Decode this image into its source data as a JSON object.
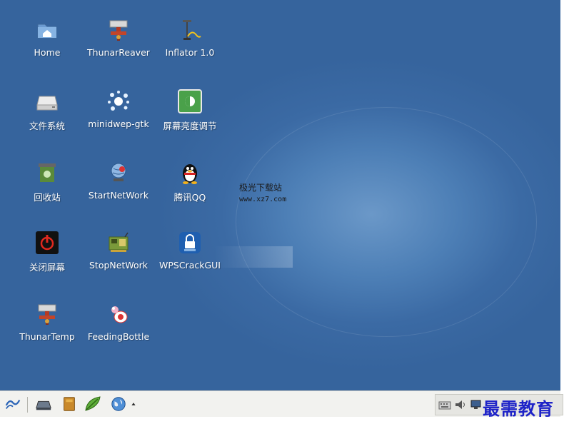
{
  "desktop": {
    "icons": [
      {
        "label": "Home",
        "icon": "home-folder-icon"
      },
      {
        "label": "ThunarReaver",
        "icon": "hydrant-icon"
      },
      {
        "label": "Inflator 1.0",
        "icon": "pump-icon"
      },
      {
        "label": "文件系统",
        "icon": "drive-icon"
      },
      {
        "label": "minidwep-gtk",
        "icon": "splash-icon"
      },
      {
        "label": "屏幕亮度调节",
        "icon": "brightness-icon"
      },
      {
        "label": "回收站",
        "icon": "trash-icon"
      },
      {
        "label": "StartNetWork",
        "icon": "network-globe-icon"
      },
      {
        "label": "腾讯QQ",
        "icon": "penguin-icon"
      },
      {
        "label": "关闭屏幕",
        "icon": "power-icon"
      },
      {
        "label": "StopNetWork",
        "icon": "network-card-icon"
      },
      {
        "label": "WPSCrackGUI",
        "icon": "wps-lock-icon"
      },
      {
        "label": "ThunarTemp",
        "icon": "hydrant-icon"
      },
      {
        "label": "FeedingBottle",
        "icon": "feeding-bottle-icon"
      }
    ],
    "watermark": {
      "line1": "极光下载站",
      "line2": "www.xz7.com"
    }
  },
  "taskbar": {
    "launchers": [
      "app-menu-icon",
      "show-desktop-icon",
      "file-manager-icon",
      "text-editor-icon",
      "web-browser-icon",
      "more-arrow-icon"
    ],
    "tray": [
      "keyboard-icon",
      "volume-icon",
      "network-monitor-icon"
    ]
  },
  "overlay": {
    "logo_text": "最需教育"
  },
  "colors": {
    "desktop": "#3b6aa4",
    "taskbar": "#f2f2ef",
    "logo": "#1e23c8"
  }
}
